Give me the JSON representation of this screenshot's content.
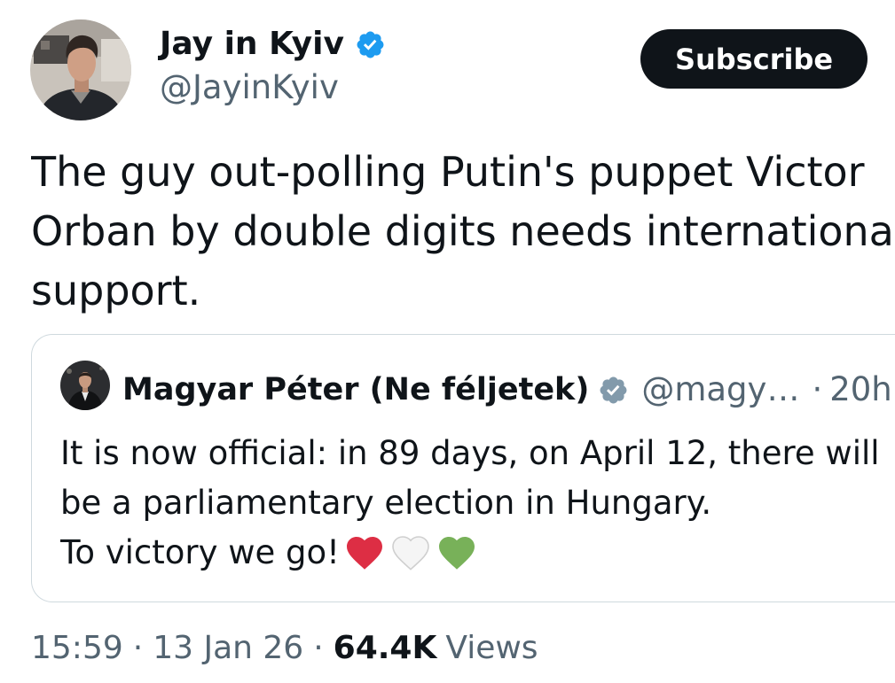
{
  "author": {
    "name": "Jay in Kyiv",
    "handle": "@JayinKyiv",
    "badge_icon": "verified-badge-icon",
    "badge_color": "#1d9bf0"
  },
  "subscribe_label": "Subscribe",
  "tweet": {
    "lines": [
      "The guy out-polling Putin's puppet Victor",
      "Orban by double digits needs internationa",
      "support."
    ]
  },
  "quote": {
    "name": "Magyar Péter (Ne féljetek)",
    "badge_icon": "verified-badge-icon",
    "badge_color": "#829aab",
    "handle": "@magy…",
    "separator": "·",
    "time": "20h",
    "lines": [
      "It is now official: in 89 days, on April 12, there will",
      "be a parliamentary election in Hungary.",
      "To victory we go!"
    ],
    "emoji_icons": [
      {
        "name": "red-heart-icon",
        "color": "#dd2e44"
      },
      {
        "name": "white-heart-icon",
        "color": "#f5f5f5"
      },
      {
        "name": "green-heart-icon",
        "color": "#78b159"
      }
    ]
  },
  "meta": {
    "time": "15:59",
    "separator": "·",
    "date": "13 Jan 26",
    "views_count": "64.4K",
    "views_label": "Views"
  },
  "colors": {
    "text": "#0f1419",
    "secondary_text": "#536471",
    "border": "#cfd9de",
    "button_bg": "#0f1419"
  }
}
